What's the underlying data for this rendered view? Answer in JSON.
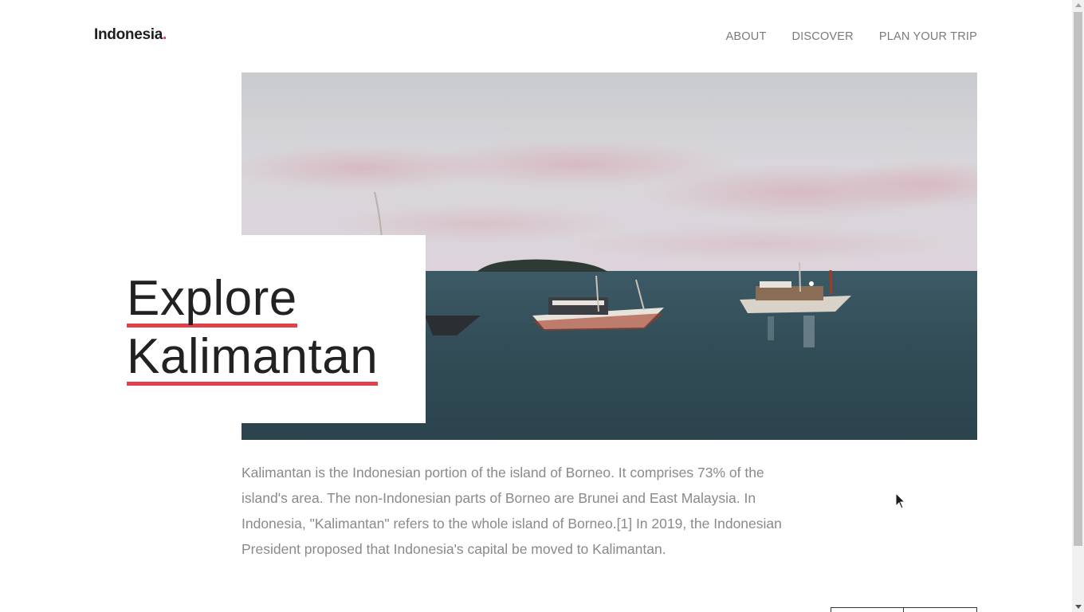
{
  "header": {
    "logo_text": "Indonesia",
    "logo_dot": ".",
    "nav": [
      {
        "label": "ABOUT"
      },
      {
        "label": "DISCOVER"
      },
      {
        "label": "PLAN YOUR TRIP"
      }
    ]
  },
  "hero": {
    "title_line1": "Explore",
    "title_line2": "Kalimantan",
    "image_description": "sea-with-boats-photo"
  },
  "content": {
    "description": "Kalimantan is the Indonesian portion of the island of Borneo. It comprises 73% of the island's area. The non-Indonesian parts of Borneo are Brunei and East Malaysia. In Indonesia, \"Kalimantan\" refers to the whole island of Borneo.[1] In 2019, the Indonesian President proposed that Indonesia's capital be moved to Kalimantan."
  },
  "colors": {
    "accent": "#e0414b",
    "text_dark": "#222222",
    "text_muted": "#8a8a8a",
    "nav_text": "#7a7a7a"
  }
}
